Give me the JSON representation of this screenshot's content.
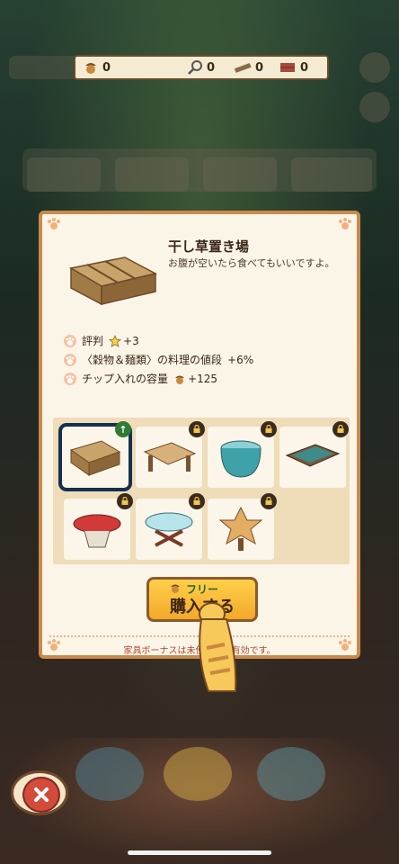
{
  "resources": {
    "acorns": "0",
    "magnifier": "0",
    "planks": "0",
    "bricks": "0"
  },
  "item": {
    "title": "干し草置き場",
    "description": "お腹が空いたら食べてもいいですよ。"
  },
  "stats": [
    {
      "label": "評判",
      "value": "+3",
      "icon": "star-icon"
    },
    {
      "label": "〈穀物＆麺類〉の料理の値段",
      "value": "+6%"
    },
    {
      "label": "チップ入れの容量",
      "value": "+125",
      "icon": "acorn-icon"
    }
  ],
  "variants": [
    {
      "name": "hay-bale",
      "state": "selected",
      "badge": "upgrade-arrow-icon"
    },
    {
      "name": "wooden-table",
      "state": "locked"
    },
    {
      "name": "teal-pot",
      "state": "locked"
    },
    {
      "name": "teal-bench",
      "state": "locked"
    },
    {
      "name": "red-round-table",
      "state": "locked"
    },
    {
      "name": "light-blue-round-table",
      "state": "locked"
    },
    {
      "name": "star-shaped-table",
      "state": "locked"
    }
  ],
  "buy": {
    "free_label": "フリー",
    "button_label": "購入する"
  },
  "bonus_text": "家具ボーナスは未使用でも有効です。",
  "colors": {
    "panel_border": "#c98a4c",
    "panel_bg": "#fbf5e8",
    "buy_button": "#f3a92a",
    "selected_outline": "#14314f",
    "bonus_text": "#b24330"
  }
}
